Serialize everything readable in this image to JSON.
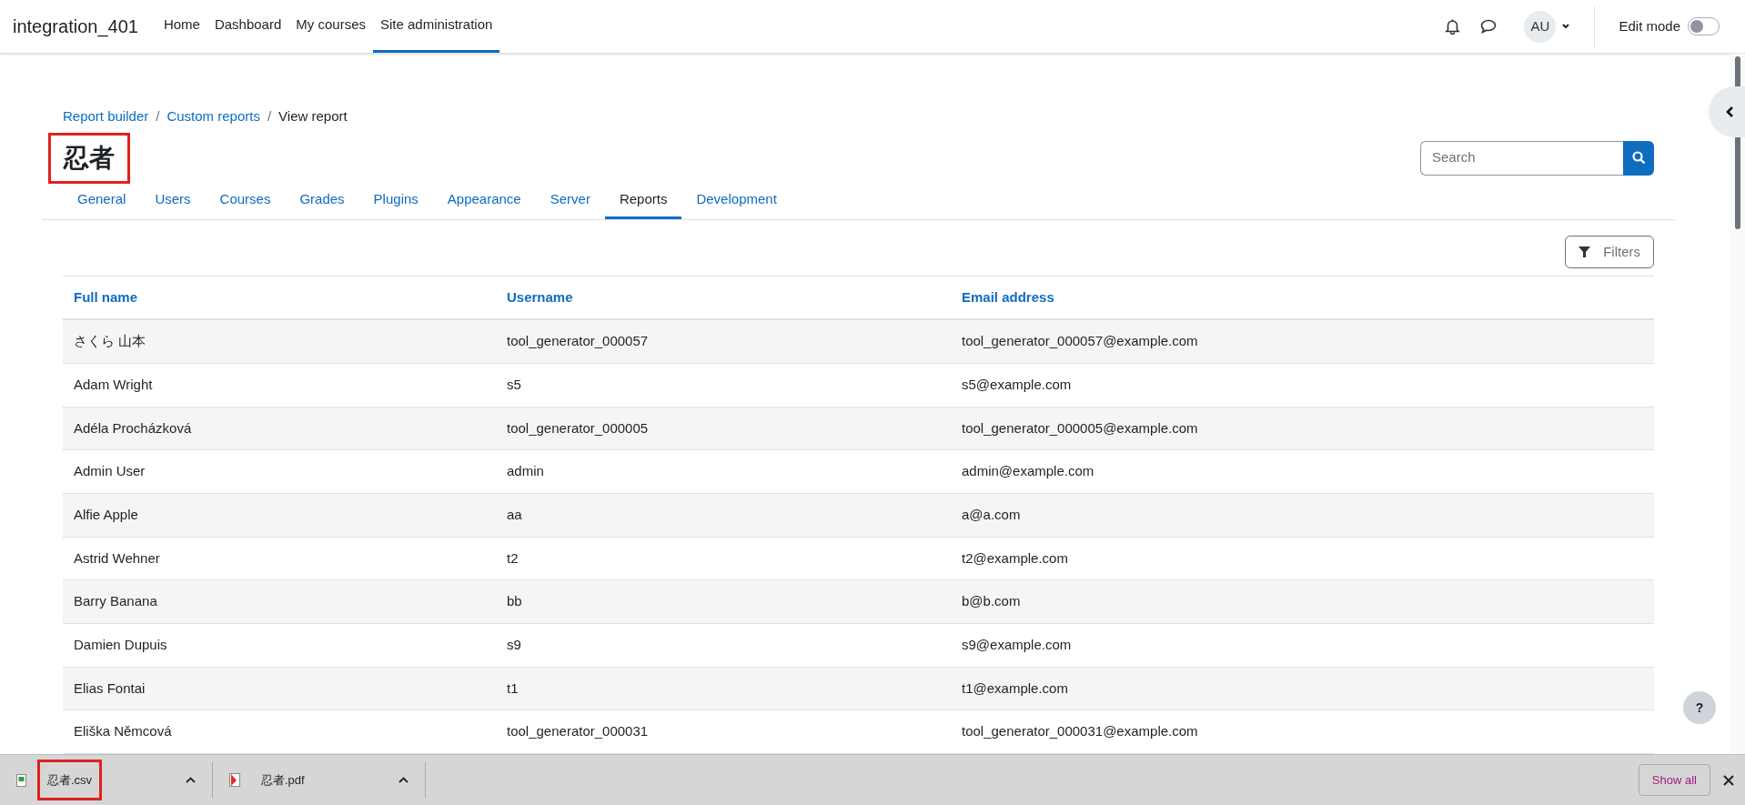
{
  "site_name": "integration_401",
  "primary_nav": [
    {
      "label": "Home",
      "selected": false
    },
    {
      "label": "Dashboard",
      "selected": false
    },
    {
      "label": "My courses",
      "selected": false
    },
    {
      "label": "Site administration",
      "selected": true
    }
  ],
  "user_menu": {
    "initials": "AU"
  },
  "edit_mode": {
    "label": "Edit mode",
    "on": false
  },
  "breadcrumb": [
    {
      "label": "Report builder",
      "kind": "link"
    },
    {
      "label": "/",
      "kind": "separator"
    },
    {
      "label": "Custom reports",
      "kind": "link"
    },
    {
      "label": "/",
      "kind": "separator"
    },
    {
      "label": "View report",
      "kind": "current"
    }
  ],
  "page_title": {
    "text": "忍者",
    "highlighted": true
  },
  "search": {
    "placeholder": "Search"
  },
  "tabs": [
    {
      "label": "General",
      "selected": false
    },
    {
      "label": "Users",
      "selected": false
    },
    {
      "label": "Courses",
      "selected": false
    },
    {
      "label": "Grades",
      "selected": false
    },
    {
      "label": "Plugins",
      "selected": false
    },
    {
      "label": "Appearance",
      "selected": false
    },
    {
      "label": "Server",
      "selected": false
    },
    {
      "label": "Reports",
      "selected": true
    },
    {
      "label": "Development",
      "selected": false
    }
  ],
  "filters_button": "Filters",
  "table": {
    "columns": [
      "Full name",
      "Username",
      "Email address"
    ],
    "rows": [
      [
        "さくら 山本",
        "tool_generator_000057",
        "tool_generator_000057@example.com"
      ],
      [
        "Adam Wright",
        "s5",
        "s5@example.com"
      ],
      [
        "Adéla Procházková",
        "tool_generator_000005",
        "tool_generator_000005@example.com"
      ],
      [
        "Admin User",
        "admin",
        "admin@example.com"
      ],
      [
        "Alfie Apple",
        "aa",
        "a@a.com"
      ],
      [
        "Astrid Wehner",
        "t2",
        "t2@example.com"
      ],
      [
        "Barry Banana",
        "bb",
        "b@b.com"
      ],
      [
        "Damien Dupuis",
        "s9",
        "s9@example.com"
      ],
      [
        "Elias Fontai",
        "t1",
        "t1@example.com"
      ],
      [
        "Eliška Němcová",
        "tool_generator_000031",
        "tool_generator_000031@example.com"
      ]
    ]
  },
  "help_button": "?",
  "downloads": [
    {
      "filename": "忍者.csv",
      "kind": "csv",
      "highlighted": true
    },
    {
      "filename": "忍者.pdf",
      "kind": "pdf",
      "highlighted": false
    }
  ],
  "show_all_button": "Show all"
}
